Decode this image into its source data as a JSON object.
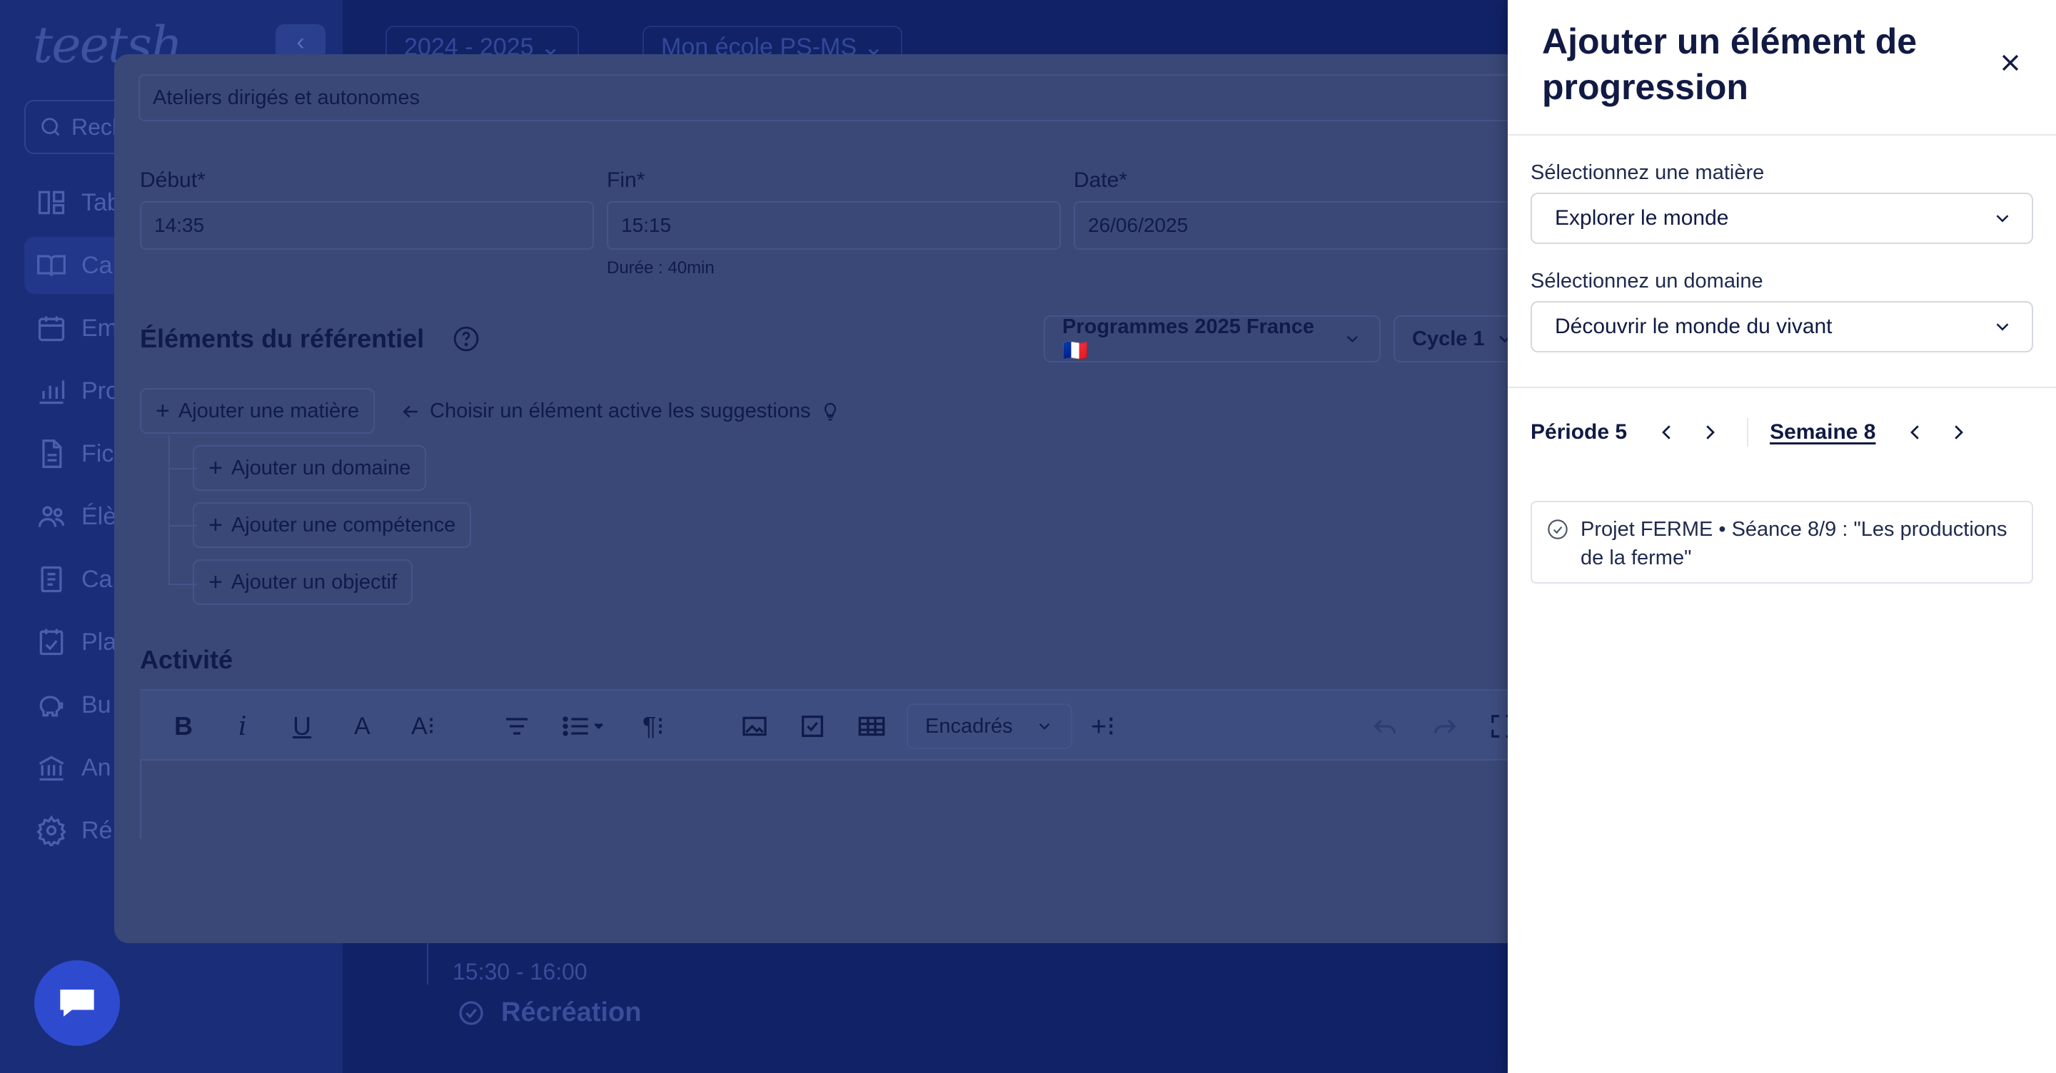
{
  "sidebar": {
    "logo": "teetsh",
    "search_placeholder": "Rech",
    "items": [
      {
        "label": "Tab",
        "icon": "dashboard-icon"
      },
      {
        "label": "Ca",
        "icon": "book-icon"
      },
      {
        "label": "Em",
        "icon": "calendar-icon"
      },
      {
        "label": "Pro",
        "icon": "chart-icon"
      },
      {
        "label": "Fic",
        "icon": "file-icon"
      },
      {
        "label": "Élè",
        "icon": "users-icon"
      },
      {
        "label": "Ca",
        "icon": "notebook-icon"
      },
      {
        "label": "Pla",
        "icon": "planning-icon"
      },
      {
        "label": "Bu",
        "icon": "piggy-bank-icon"
      },
      {
        "label": "An",
        "icon": "bank-icon"
      },
      {
        "label": "Ré",
        "icon": "gear-icon"
      }
    ]
  },
  "background": {
    "year_select": "2024 - 2025",
    "school_select": "Mon école PS-MS",
    "time_range": "15:30 - 16:00",
    "slot_title": "Récréation"
  },
  "modal": {
    "title_value": "Ateliers dirigés et autonomes",
    "start_label": "Début*",
    "start_value": "14:35",
    "end_label": "Fin*",
    "end_value": "15:15",
    "date_label": "Date*",
    "date_value": "26/06/2025",
    "duration": "Durée : 40min",
    "referential_title": "Éléments du référentiel",
    "program_select": "Programmes 2025 France 🇫🇷",
    "cycle_select": "Cycle 1",
    "add_subject": "Ajouter une matière",
    "hint": "Choisir un élément active les suggestions",
    "add_domain": "Ajouter un domaine",
    "add_skill": "Ajouter une compétence",
    "add_objective": "Ajouter un objectif",
    "activity_title": "Activité",
    "toolbar_boxes": "Encadrés"
  },
  "panel": {
    "title": "Ajouter un élément de progression",
    "subject_label": "Sélectionnez une matière",
    "subject_value": "Explorer le monde",
    "domain_label": "Sélectionnez un domaine",
    "domain_value": "Découvrir le monde du vivant",
    "period_label": "Période 5",
    "week_label": "Semaine 8",
    "items": [
      {
        "text": "Projet FERME • Séance 8/9 : \"Les productions de la ferme\""
      }
    ]
  },
  "colors": {
    "overlay": "#0f2167",
    "chat_button": "#2e4bd0",
    "panel_bg": "#ffffff",
    "text_dark": "#111a43"
  }
}
